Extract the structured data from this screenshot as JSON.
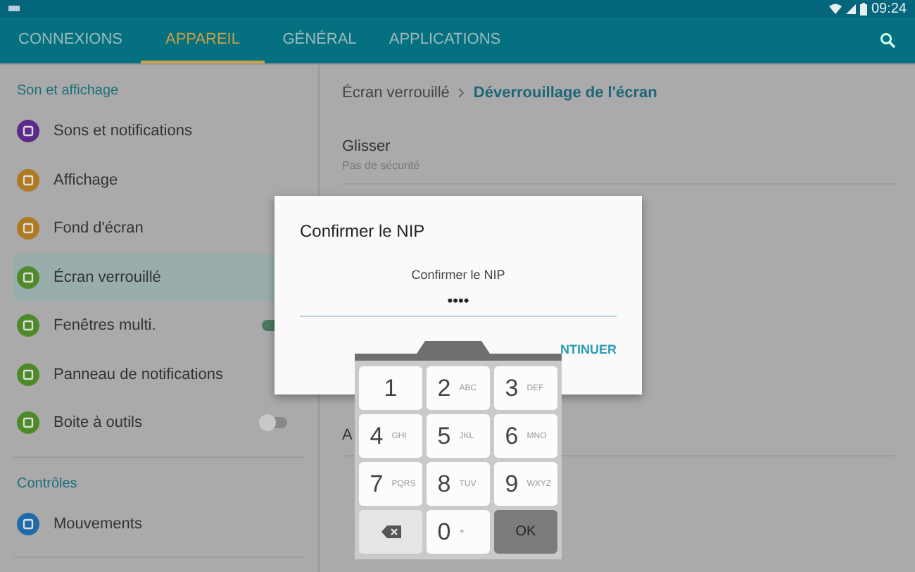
{
  "status_bar": {
    "time": "09:24"
  },
  "tabs": [
    {
      "label": "CONNEXIONS",
      "selected": false
    },
    {
      "label": "APPAREIL",
      "selected": true
    },
    {
      "label": "GÉNÉRAL",
      "selected": false
    },
    {
      "label": "APPLICATIONS",
      "selected": false
    }
  ],
  "sidebar": {
    "sections": [
      {
        "title": "Son et affichage",
        "items": [
          {
            "label": "Sons et notifications",
            "color": "#5b2a8a",
            "selected": false
          },
          {
            "label": "Affichage",
            "color": "#b07a22",
            "selected": false
          },
          {
            "label": "Fond d'écran",
            "color": "#b07a22",
            "selected": false
          },
          {
            "label": "Écran verrouillé",
            "color": "#4f8a2a",
            "selected": true
          },
          {
            "label": "Fenêtres multi.",
            "color": "#4f8a2a",
            "selected": false,
            "toggle": {
              "on": true
            }
          },
          {
            "label": "Panneau de notifications",
            "color": "#4f8a2a",
            "selected": false
          },
          {
            "label": "Boite à outils",
            "color": "#4f8a2a",
            "selected": false,
            "toggle": {
              "on": false
            }
          }
        ]
      },
      {
        "title": "Contrôles",
        "items": [
          {
            "label": "Mouvements",
            "color": "#1f6aa8",
            "selected": false
          }
        ]
      }
    ]
  },
  "breadcrumb": {
    "parent": "Écran verrouillé",
    "current": "Déverrouillage de l'écran"
  },
  "options": [
    {
      "title": "Glisser",
      "subtitle": "Pas de sécurité"
    },
    {
      "title": "A"
    }
  ],
  "dialog": {
    "title": "Confirmer le NIP",
    "field_label": "Confirmer le NIP",
    "value": "••••",
    "button": "NTINUER"
  },
  "keypad": {
    "keys": [
      {
        "kind": "digit",
        "digit": "1"
      },
      {
        "kind": "digit",
        "digit": "2",
        "letters": "ABC"
      },
      {
        "kind": "digit",
        "digit": "3",
        "letters": "DEF"
      },
      {
        "kind": "digit",
        "digit": "4",
        "letters": "GHI"
      },
      {
        "kind": "digit",
        "digit": "5",
        "letters": "JKL"
      },
      {
        "kind": "digit",
        "digit": "6",
        "letters": "MNO"
      },
      {
        "kind": "digit",
        "digit": "7",
        "letters": "PQRS"
      },
      {
        "kind": "digit",
        "digit": "8",
        "letters": "TUV"
      },
      {
        "kind": "digit",
        "digit": "9",
        "letters": "WXYZ"
      },
      {
        "kind": "delete"
      },
      {
        "kind": "digit",
        "digit": "0",
        "letters": "+"
      },
      {
        "kind": "ok",
        "label": "OK"
      }
    ]
  }
}
